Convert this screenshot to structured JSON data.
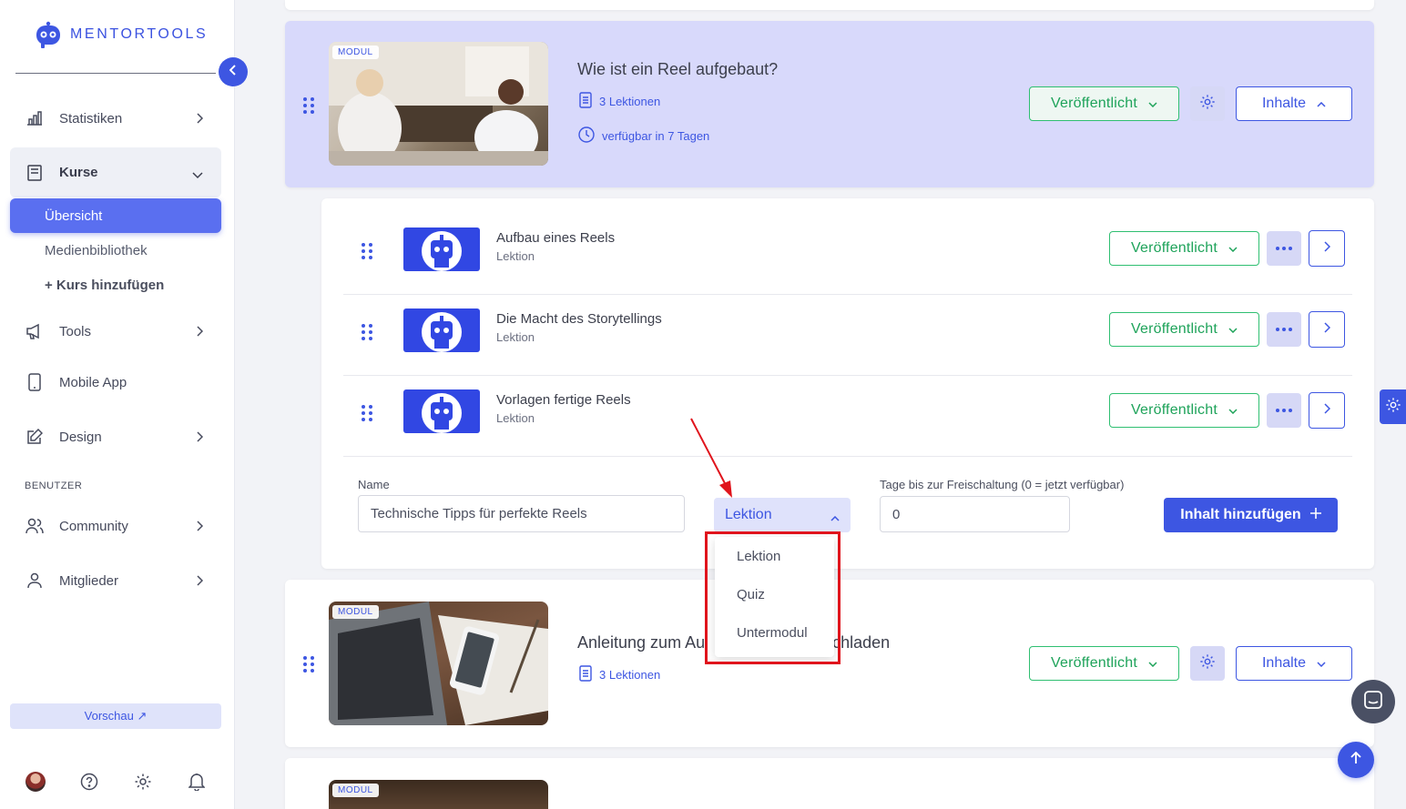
{
  "app": {
    "brand": "MENTORTOOLS",
    "accent_color": "#3d56e2",
    "published_color": "#1ea35a",
    "highlight_color": "#e0141c"
  },
  "sidebar": {
    "items": [
      {
        "label": "Statistiken",
        "icon": "bar-chart-icon"
      },
      {
        "label": "Kurse",
        "icon": "book-icon"
      },
      {
        "label": "Tools",
        "icon": "megaphone-icon"
      },
      {
        "label": "Mobile App",
        "icon": "smartphone-icon"
      },
      {
        "label": "Design",
        "icon": "pencil-icon"
      }
    ],
    "kurse_sub": {
      "overview": "Übersicht",
      "media": "Medienbibliothek",
      "add_course": "+ Kurs hinzufügen"
    },
    "section_users": "BENUTZER",
    "user_items": [
      {
        "label": "Community",
        "icon": "users-icon"
      },
      {
        "label": "Mitglieder",
        "icon": "user-icon"
      }
    ],
    "preview_label": "Vorschau ↗"
  },
  "modules": [
    {
      "tag": "MODUL",
      "title": "Wie ist ein Reel aufgebaut?",
      "lessons_count": "3 Lektionen",
      "availability": "verfügbar in 7 Tagen",
      "status": "Veröffentlicht",
      "contents_label": "Inhalte",
      "expanded": true
    },
    {
      "tag": "MODUL",
      "title_left": "Anleitung zum Au",
      "title_right": "chladen",
      "lessons_count": "3 Lektionen",
      "status": "Veröffentlicht",
      "contents_label": "Inhalte",
      "expanded": false
    },
    {
      "tag": "MODUL"
    }
  ],
  "lessons": [
    {
      "title": "Aufbau eines Reels",
      "type": "Lektion",
      "status": "Veröffentlicht"
    },
    {
      "title": "Die Macht des Storytellings",
      "type": "Lektion",
      "status": "Veröffentlicht"
    },
    {
      "title": "Vorlagen fertige Reels",
      "type": "Lektion",
      "status": "Veröffentlicht"
    }
  ],
  "add_form": {
    "name_label": "Name",
    "name_value": "Technische Tipps für perfekte Reels",
    "type_selected": "Lektion",
    "type_options": [
      "Lektion",
      "Quiz",
      "Untermodul"
    ],
    "days_label": "Tage bis zur Freischaltung (0 = jetzt verfügbar)",
    "days_value": "0",
    "submit_label": "Inhalt hinzufügen"
  }
}
